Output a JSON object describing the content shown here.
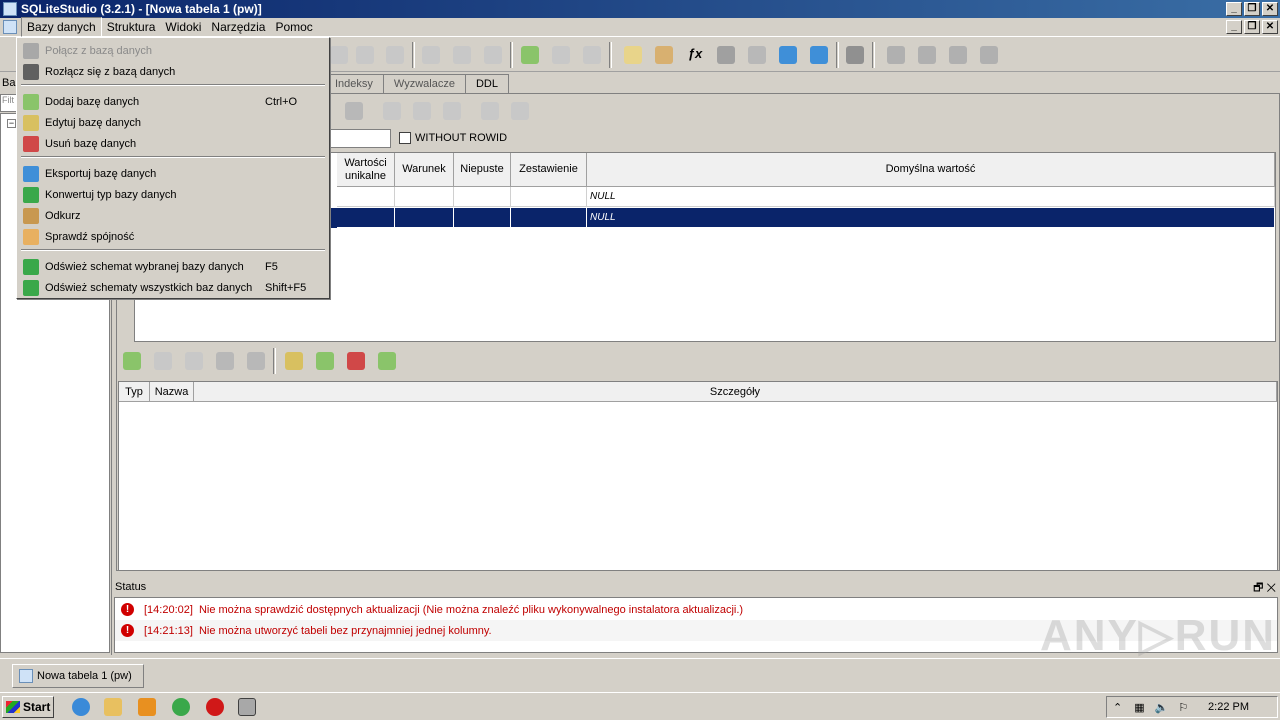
{
  "window": {
    "title": "SQLiteStudio (3.2.1) - [Nowa tabela 1 (pw)]",
    "controls": [
      "_",
      "❐",
      "✕"
    ]
  },
  "menubar": {
    "items": [
      "Bazy danych",
      "Struktura",
      "Widoki",
      "Narzędzia",
      "Pomoc"
    ]
  },
  "dbmenu": {
    "items": [
      {
        "label": "Połącz z bazą danych",
        "shortcut": "",
        "enabled": false,
        "icon": "plug-connect-icon"
      },
      {
        "label": "Rozłącz się z bazą danych",
        "shortcut": "",
        "enabled": true,
        "icon": "plug-disconnect-icon"
      },
      {
        "label": "Dodaj bazę danych",
        "shortcut": "Ctrl+O",
        "enabled": true,
        "icon": "database-add-icon"
      },
      {
        "label": "Edytuj bazę danych",
        "shortcut": "",
        "enabled": true,
        "icon": "database-edit-icon"
      },
      {
        "label": "Usuń bazę danych",
        "shortcut": "",
        "enabled": true,
        "icon": "database-delete-icon"
      },
      {
        "label": "Eksportuj bazę danych",
        "shortcut": "",
        "enabled": true,
        "icon": "database-export-icon"
      },
      {
        "label": "Konwertuj typ bazy danych",
        "shortcut": "",
        "enabled": true,
        "icon": "database-convert-icon"
      },
      {
        "label": "Odkurz",
        "shortcut": "",
        "enabled": true,
        "icon": "broom-icon"
      },
      {
        "label": "Sprawdź spójność",
        "shortcut": "",
        "enabled": true,
        "icon": "integrity-check-icon"
      },
      {
        "label": "Odśwież schemat wybranej bazy danych",
        "shortcut": "F5",
        "enabled": true,
        "icon": "refresh-schema-icon"
      },
      {
        "label": "Odśwież schematy wszystkich baz danych",
        "shortcut": "Shift+F5",
        "enabled": true,
        "icon": "refresh-all-schemas-icon"
      }
    ]
  },
  "left_panel": {
    "label": "Ba",
    "filter_placeholder": "Filt",
    "tree_expander": "−"
  },
  "tabs": [
    "Indeksy",
    "Wyzwalacze",
    "DDL"
  ],
  "table_editor": {
    "without_rowid_label": "WITHOUT ROWID",
    "column_headers": [
      "Wartości unikalne",
      "Warunek",
      "Niepuste",
      "Zestawienie",
      "Domyślna wartość"
    ],
    "rows": [
      {
        "default": "NULL",
        "selected": false
      },
      {
        "default": "NULL",
        "selected": true
      }
    ]
  },
  "constraints": {
    "headers": [
      "Typ",
      "Nazwa",
      "Szczegóły"
    ]
  },
  "status": {
    "title": "Status",
    "controls": "🗗 ✕",
    "messages": [
      {
        "time": "[14:20:02]",
        "text": "Nie można sprawdzić dostępnych aktualizacji (Nie można znaleźć pliku wykonywalnego instalatora aktualizacji.)"
      },
      {
        "time": "[14:21:13]",
        "text": "Nie można utworzyć tabeli bez przynajmniej jednej kolumny."
      }
    ]
  },
  "window_bar": {
    "task_label": "Nowa tabela 1 (pw)"
  },
  "taskbar": {
    "start_label": "Start",
    "clock": "2:22 PM"
  },
  "watermark": "ANY▷RUN",
  "colors": {
    "title_bar": "#0a246a",
    "selection": "#0a246a",
    "error_text": "#c00000",
    "chrome": "#d4d0c8"
  }
}
